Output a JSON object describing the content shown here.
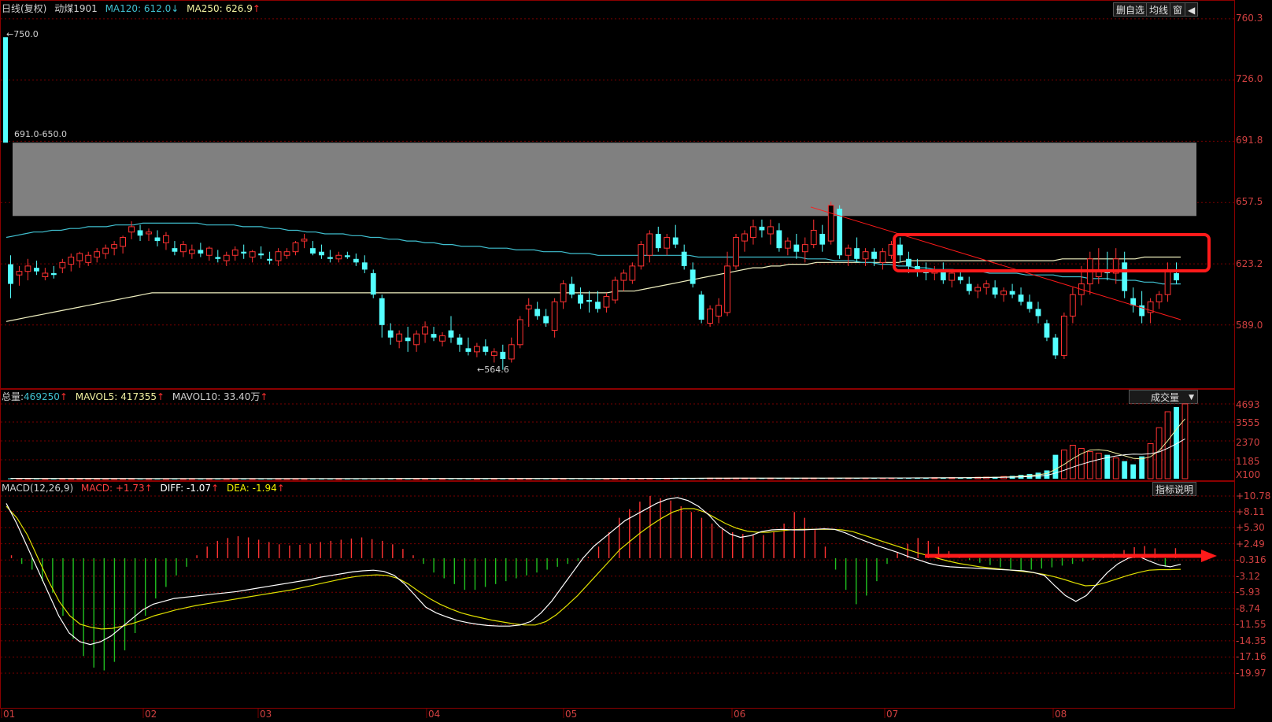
{
  "header": {
    "period": "日线(复权)",
    "symbol": "动煤1901",
    "ma120_label": "MA120:",
    "ma120_value": "612.0",
    "ma120_arrow": "↓",
    "ma250_label": "MA250:",
    "ma250_value": "626.9",
    "ma250_arrow": "↑"
  },
  "toolbar": {
    "delete_label": "删自选",
    "ma_label": "均线",
    "window_label": "窗",
    "collapse_label": "◀"
  },
  "price_axis": [
    "760.3",
    "726.0",
    "691.8",
    "657.5",
    "623.2",
    "589.0"
  ],
  "annotations": {
    "high": "750.0",
    "low": "564.6",
    "zone": "691.0-650.0"
  },
  "volume": {
    "total_label": "总量:",
    "total_value": "469250",
    "total_arrow": "↑",
    "mavol5_label": "MAVOL5:",
    "mavol5_value": "417355",
    "mavol5_arrow": "↑",
    "mavol10_label": "MAVOL10:",
    "mavol10_value": "33.40万",
    "mavol10_arrow": "↑",
    "selector_label": "成交量",
    "axis": [
      "4693",
      "3555",
      "2370",
      "1185",
      "X100"
    ]
  },
  "macd": {
    "title": "MACD(12,26,9)",
    "macd_label": "MACD:",
    "macd_value": "+1.73",
    "macd_arrow": "↑",
    "diff_label": "DIFF:",
    "diff_value": "-1.07",
    "diff_arrow": "↑",
    "dea_label": "DEA:",
    "dea_value": "-1.94",
    "dea_arrow": "↑",
    "help_label": "指标说明",
    "axis": [
      "+10.78",
      "+8.11",
      "+5.30",
      "+2.49",
      "-0.316",
      "-3.12",
      "-5.93",
      "-8.74",
      "-11.55",
      "-14.35",
      "-17.16",
      "-19.97"
    ]
  },
  "x_axis": [
    "01",
    "02",
    "03",
    "04",
    "05",
    "06",
    "07",
    "08"
  ],
  "colors": {
    "up": "#ff3232",
    "down": "#54ffff",
    "ma120": "#f0f0c0",
    "ma250": "#40c0d0",
    "grid": "#7a0000",
    "highlight": "#ff1a1a"
  },
  "chart_data": {
    "type": "candlestick",
    "ylim": [
      555,
      762
    ],
    "zone": [
      650.0,
      691.0
    ],
    "candles": [
      [
        623,
        628,
        604,
        612
      ],
      [
        617,
        622,
        611,
        619
      ],
      [
        619,
        626,
        614,
        622
      ],
      [
        621,
        625,
        617,
        619
      ],
      [
        616,
        621,
        614,
        618
      ],
      [
        618,
        622,
        615,
        617
      ],
      [
        621,
        626,
        618,
        624
      ],
      [
        623,
        629,
        619,
        627
      ],
      [
        625,
        630,
        621,
        629
      ],
      [
        624,
        630,
        622,
        628
      ],
      [
        627,
        632,
        624,
        630
      ],
      [
        629,
        634,
        626,
        632
      ],
      [
        632,
        636,
        628,
        634
      ],
      [
        633,
        639,
        629,
        638
      ],
      [
        641,
        647,
        637,
        644
      ],
      [
        642,
        645,
        636,
        639
      ],
      [
        640,
        643,
        636,
        641
      ],
      [
        638,
        642,
        633,
        636
      ],
      [
        635,
        641,
        631,
        639
      ],
      [
        632,
        636,
        628,
        630
      ],
      [
        630,
        636,
        627,
        634
      ],
      [
        629,
        634,
        626,
        631
      ],
      [
        631,
        635,
        627,
        629
      ],
      [
        628,
        633,
        625,
        632
      ],
      [
        627,
        631,
        624,
        626
      ],
      [
        625,
        630,
        622,
        628
      ],
      [
        628,
        633,
        625,
        631
      ],
      [
        630,
        634,
        626,
        629
      ],
      [
        627,
        631,
        624,
        630
      ],
      [
        629,
        633,
        626,
        628
      ],
      [
        626,
        630,
        623,
        625
      ],
      [
        625,
        632,
        622,
        630
      ],
      [
        628,
        632,
        626,
        630
      ],
      [
        630,
        636,
        628,
        635
      ],
      [
        636,
        640,
        632,
        637
      ],
      [
        632,
        636,
        628,
        629
      ],
      [
        630,
        634,
        626,
        628
      ],
      [
        627,
        631,
        624,
        626
      ],
      [
        626,
        630,
        624,
        628
      ],
      [
        628,
        630,
        626,
        627
      ],
      [
        626,
        629,
        622,
        624
      ],
      [
        624,
        628,
        618,
        620
      ],
      [
        618,
        620,
        604,
        606
      ],
      [
        604,
        606,
        582,
        589
      ],
      [
        586,
        590,
        578,
        582
      ],
      [
        580,
        586,
        576,
        584
      ],
      [
        582,
        588,
        574,
        580
      ],
      [
        578,
        586,
        574,
        584
      ],
      [
        584,
        591,
        579,
        588
      ],
      [
        584,
        588,
        580,
        582
      ],
      [
        580,
        585,
        577,
        583
      ],
      [
        586,
        594,
        579,
        582
      ],
      [
        582,
        584,
        574,
        578
      ],
      [
        576,
        582,
        572,
        574
      ],
      [
        574,
        579,
        571,
        577
      ],
      [
        577,
        581,
        572,
        574
      ],
      [
        572,
        576,
        568,
        574
      ],
      [
        574,
        578,
        564,
        570
      ],
      [
        570,
        582,
        568,
        578
      ],
      [
        578,
        594,
        576,
        592
      ],
      [
        598,
        604,
        588,
        600
      ],
      [
        598,
        602,
        592,
        594
      ],
      [
        594,
        598,
        588,
        590
      ],
      [
        586,
        604,
        582,
        602
      ],
      [
        602,
        614,
        598,
        612
      ],
      [
        612,
        616,
        604,
        606
      ],
      [
        606,
        610,
        598,
        601
      ],
      [
        603,
        608,
        596,
        602
      ],
      [
        602,
        608,
        596,
        598
      ],
      [
        599,
        607,
        596,
        605
      ],
      [
        603,
        616,
        601,
        614
      ],
      [
        614,
        620,
        608,
        618
      ],
      [
        614,
        624,
        612,
        622
      ],
      [
        622,
        636,
        620,
        634
      ],
      [
        628,
        642,
        624,
        640
      ],
      [
        640,
        644,
        630,
        632
      ],
      [
        632,
        640,
        628,
        638
      ],
      [
        638,
        645,
        632,
        634
      ],
      [
        630,
        634,
        620,
        622
      ],
      [
        620,
        624,
        610,
        612
      ],
      [
        606,
        608,
        590,
        592
      ],
      [
        590,
        600,
        588,
        598
      ],
      [
        594,
        604,
        590,
        600
      ],
      [
        596,
        630,
        594,
        622
      ],
      [
        622,
        640,
        620,
        638
      ],
      [
        636,
        642,
        630,
        640
      ],
      [
        638,
        648,
        634,
        644
      ],
      [
        644,
        648,
        638,
        642
      ],
      [
        640,
        648,
        634,
        644
      ],
      [
        642,
        646,
        630,
        632
      ],
      [
        632,
        638,
        628,
        636
      ],
      [
        634,
        640,
        626,
        630
      ],
      [
        630,
        638,
        624,
        634
      ],
      [
        634,
        648,
        632,
        642
      ],
      [
        640,
        645,
        630,
        634
      ],
      [
        636,
        658,
        634,
        656
      ],
      [
        654,
        656,
        626,
        628
      ],
      [
        628,
        634,
        622,
        632
      ],
      [
        632,
        638,
        624,
        626
      ],
      [
        626,
        632,
        622,
        630
      ],
      [
        630,
        632,
        622,
        626
      ],
      [
        624,
        632,
        620,
        630
      ],
      [
        628,
        636,
        626,
        634
      ],
      [
        634,
        638,
        624,
        628
      ],
      [
        626,
        630,
        618,
        622
      ],
      [
        622,
        626,
        616,
        620
      ],
      [
        620,
        624,
        614,
        618
      ],
      [
        618,
        622,
        614,
        620
      ],
      [
        620,
        624,
        612,
        614
      ],
      [
        614,
        620,
        610,
        618
      ],
      [
        616,
        620,
        612,
        614
      ],
      [
        612,
        616,
        606,
        608
      ],
      [
        608,
        612,
        604,
        610
      ],
      [
        610,
        614,
        606,
        612
      ],
      [
        610,
        614,
        604,
        606
      ],
      [
        606,
        610,
        602,
        608
      ],
      [
        608,
        612,
        604,
        606
      ],
      [
        606,
        610,
        600,
        602
      ],
      [
        602,
        606,
        596,
        598
      ],
      [
        598,
        602,
        590,
        594
      ],
      [
        590,
        592,
        580,
        582
      ],
      [
        582,
        584,
        570,
        572
      ],
      [
        572,
        596,
        570,
        594
      ],
      [
        594,
        610,
        590,
        606
      ],
      [
        606,
        622,
        600,
        612
      ],
      [
        612,
        630,
        606,
        626
      ],
      [
        616,
        632,
        612,
        620
      ],
      [
        620,
        630,
        614,
        618
      ],
      [
        618,
        632,
        612,
        626
      ],
      [
        624,
        630,
        604,
        608
      ],
      [
        604,
        610,
        596,
        600
      ],
      [
        600,
        608,
        590,
        594
      ],
      [
        596,
        604,
        590,
        602
      ],
      [
        602,
        608,
        598,
        606
      ],
      [
        606,
        624,
        602,
        620
      ],
      [
        618,
        624,
        612,
        614
      ]
    ],
    "ma120": [
      591,
      592,
      593,
      594,
      595,
      596,
      597,
      598,
      599,
      600,
      601,
      602,
      603,
      604,
      605,
      606,
      607,
      607,
      607,
      607,
      607,
      607,
      607,
      607,
      607,
      607,
      607,
      607,
      607,
      607,
      607,
      607,
      607,
      607,
      607,
      607,
      607,
      607,
      607,
      607,
      607,
      607,
      607,
      607,
      607,
      607,
      607,
      607,
      607,
      607,
      607,
      607,
      607,
      607,
      607,
      607,
      607,
      607,
      607,
      607,
      607,
      607,
      607,
      607,
      607,
      607,
      607,
      608,
      608,
      608,
      609,
      610,
      611,
      612,
      613,
      614,
      615,
      616,
      617,
      618,
      619,
      620,
      621,
      621,
      622,
      622,
      623,
      623,
      623,
      624,
      624,
      624,
      624,
      624,
      624,
      624,
      624,
      624,
      624,
      625,
      625,
      625,
      625,
      625,
      625,
      625,
      625,
      625,
      625,
      625,
      625,
      625,
      625,
      625,
      625,
      625,
      626,
      626,
      626,
      626,
      626,
      626,
      626,
      626,
      626,
      627,
      627,
      627,
      627,
      627
    ],
    "ma250": [
      638,
      639,
      640,
      641,
      641,
      642,
      642,
      643,
      643,
      644,
      644,
      644,
      645,
      645,
      645,
      646,
      646,
      646,
      646,
      646,
      646,
      646,
      645,
      645,
      645,
      645,
      644,
      644,
      644,
      643,
      643,
      642,
      642,
      641,
      641,
      640,
      640,
      640,
      639,
      639,
      638,
      638,
      637,
      637,
      636,
      636,
      635,
      635,
      634,
      634,
      633,
      633,
      633,
      632,
      632,
      632,
      631,
      631,
      631,
      630,
      630,
      630,
      629,
      629,
      629,
      628,
      628,
      628,
      628,
      628,
      628,
      628,
      628,
      628,
      628,
      628,
      627,
      627,
      627,
      627,
      627,
      627,
      627,
      627,
      627,
      627,
      627,
      627,
      626,
      626,
      626,
      625,
      625,
      625,
      624,
      624,
      623,
      623,
      622,
      622,
      621,
      621,
      620,
      620,
      620,
      619,
      619,
      619,
      618,
      618,
      618,
      618,
      617,
      617,
      617,
      617,
      616,
      616,
      616,
      615,
      615,
      615,
      614,
      614,
      614,
      613,
      613,
      612,
      612,
      612
    ],
    "volume": [
      22,
      16,
      14,
      12,
      10,
      9,
      9,
      8,
      8,
      7,
      7,
      7,
      7,
      7,
      7,
      7,
      6,
      6,
      6,
      6,
      6,
      6,
      6,
      6,
      6,
      6,
      6,
      6,
      6,
      6,
      6,
      6,
      6,
      6,
      6,
      6,
      6,
      6,
      6,
      6,
      7,
      8,
      9,
      10,
      11,
      12,
      12,
      12,
      12,
      12,
      12,
      13,
      13,
      13,
      13,
      13,
      13,
      13,
      13,
      14,
      15,
      16,
      16,
      16,
      17,
      17,
      17,
      17,
      17,
      18,
      19,
      20,
      22,
      25,
      28,
      30,
      30,
      31,
      32,
      32,
      33,
      34,
      34,
      35,
      35,
      36,
      36,
      37,
      37,
      38,
      38,
      39,
      40,
      41,
      42,
      43,
      44,
      45,
      46,
      47,
      48,
      49,
      50,
      52,
      54,
      56,
      58,
      62,
      66,
      70,
      75,
      82,
      90,
      100,
      115,
      140,
      180,
      240,
      300,
      380,
      520,
      1500,
      1800,
      2100,
      1900,
      1700,
      1600,
      1500,
      1300,
      1100,
      900,
      1400,
      2200,
      3200,
      4200,
      4500,
      4693
    ],
    "macd_diff": [
      9.5,
      6,
      2,
      -2,
      -6,
      -10,
      -13,
      -14.5,
      -15,
      -14.5,
      -13.5,
      -12,
      -10.5,
      -9,
      -8,
      -7.5,
      -7,
      -6.8,
      -6.6,
      -6.4,
      -6.2,
      -6,
      -5.8,
      -5.5,
      -5.2,
      -4.9,
      -4.6,
      -4.3,
      -4,
      -3.7,
      -3.3,
      -3,
      -2.7,
      -2.4,
      -2.2,
      -2.1,
      -2.3,
      -3,
      -4.5,
      -6.5,
      -8.5,
      -9.5,
      -10.2,
      -10.8,
      -11.2,
      -11.5,
      -11.7,
      -11.8,
      -11.8,
      -11.6,
      -11,
      -9.5,
      -7.5,
      -5,
      -2.5,
      0,
      2,
      3.5,
      5,
      6.5,
      7.5,
      8.5,
      9.5,
      10.2,
      10.5,
      10,
      9,
      7.5,
      5.5,
      4.2,
      3.6,
      3.9,
      4.6,
      4.9,
      5,
      4.9,
      4.9,
      5,
      5.1,
      5,
      4.4,
      3.6,
      2.9,
      2.2,
      1.6,
      1,
      0.3,
      -0.3,
      -0.9,
      -1.3,
      -1.5,
      -1.6,
      -1.7,
      -1.8,
      -1.9,
      -2,
      -2.1,
      -2.2,
      -2.5,
      -3,
      -4.8,
      -6.5,
      -7.5,
      -6.5,
      -4.5,
      -2.5,
      -1,
      0,
      0.3,
      -0.5,
      -1.2,
      -1.5,
      -1.07
    ],
    "macd_dea": [
      9,
      7,
      4,
      0,
      -4,
      -7.5,
      -10,
      -11.5,
      -12,
      -12.3,
      -12.2,
      -11.8,
      -11.3,
      -10.7,
      -10,
      -9.5,
      -9,
      -8.6,
      -8.2,
      -7.9,
      -7.6,
      -7.3,
      -7,
      -6.7,
      -6.4,
      -6.1,
      -5.8,
      -5.5,
      -5.1,
      -4.7,
      -4.3,
      -3.9,
      -3.5,
      -3.2,
      -3,
      -2.9,
      -3,
      -3.5,
      -4.5,
      -5.8,
      -7,
      -8,
      -8.8,
      -9.5,
      -10,
      -10.4,
      -10.8,
      -11.1,
      -11.4,
      -11.6,
      -11.6,
      -11,
      -9.8,
      -8.2,
      -6.5,
      -4.5,
      -2.5,
      -0.5,
      1.5,
      3,
      4.5,
      5.8,
      7,
      8,
      8.6,
      8.6,
      8,
      7,
      6,
      5.2,
      4.7,
      4.5,
      4.5,
      4.7,
      4.9,
      5,
      5,
      5,
      5,
      4.9,
      4.6,
      4,
      3.4,
      2.8,
      2.2,
      1.6,
      1,
      0.5,
      0,
      -0.5,
      -0.9,
      -1.2,
      -1.5,
      -1.7,
      -1.9,
      -2.1,
      -2.3,
      -2.5,
      -2.8,
      -3.2,
      -3.7,
      -4.3,
      -4.8,
      -4.7,
      -4.2,
      -3.6,
      -3,
      -2.5,
      -2.1,
      -2,
      -2,
      -1.94
    ],
    "macd_hist": [
      0.5,
      -1,
      -2,
      -4,
      -6,
      -10,
      -14,
      -17,
      -19,
      -19.5,
      -18,
      -16,
      -13,
      -10,
      -7,
      -5,
      -3,
      -1.5,
      0.5,
      2,
      3,
      3.5,
      3.8,
      3.6,
      3.2,
      2.8,
      2.4,
      2.2,
      2.3,
      2.5,
      2.8,
      3,
      3.2,
      3.4,
      3.6,
      3.3,
      3,
      2.4,
      1.6,
      0.5,
      -1,
      -2.5,
      -3.5,
      -4.5,
      -5.5,
      -5.5,
      -5,
      -4.5,
      -4,
      -3.5,
      -3,
      -2.5,
      -2,
      -1.5,
      -1,
      -0.5,
      0.2,
      2,
      4.5,
      7,
      8.5,
      9.8,
      10.8,
      10.4,
      10,
      9,
      8,
      7,
      6,
      5,
      4.5,
      4.2,
      4,
      4,
      4.5,
      6,
      8,
      7,
      5,
      2,
      -2,
      -5.5,
      -8,
      -6.5,
      -4,
      -1,
      1,
      2.5,
      3.5,
      3,
      2,
      1.2,
      0.4,
      -0.3,
      -0.8,
      -1.2,
      -1.6,
      -1.9,
      -2.1,
      -2,
      -1.8,
      -1.6,
      -1.3,
      -1,
      -0.6,
      -0.3,
      0.2,
      0.8,
      1.4,
      1.9,
      2.1,
      1.7,
      -1.5,
      1.73
    ]
  }
}
